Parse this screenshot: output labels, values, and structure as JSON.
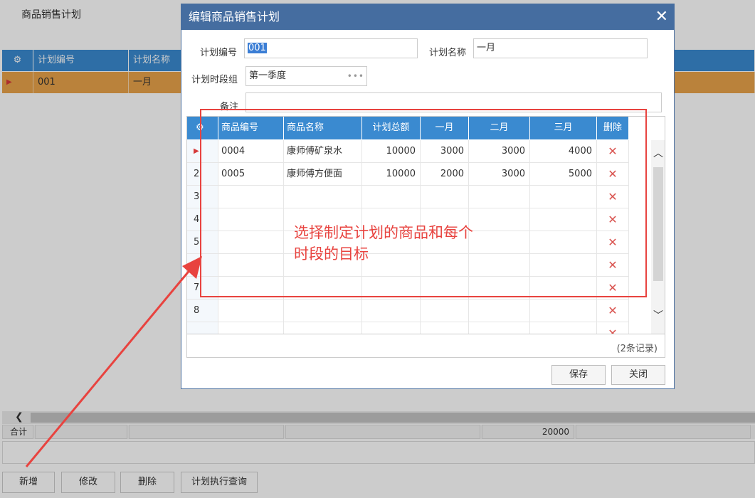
{
  "page": {
    "title": "商品销售计划"
  },
  "bg_grid": {
    "headers": [
      "计划编号",
      "计划名称"
    ],
    "row": {
      "code": "001",
      "name": "一月"
    },
    "footer": {
      "total_label": "合计",
      "total_value": "20000"
    }
  },
  "bg_buttons": {
    "add": "新增",
    "edit": "修改",
    "delete": "删除",
    "query": "计划执行查询"
  },
  "dialog": {
    "title": "编辑商品销售计划",
    "fields": {
      "code_label": "计划编号",
      "code_value": "001",
      "name_label": "计划名称",
      "name_value": "一月",
      "period_label": "计划时段组",
      "period_value": "第一季度",
      "remark_label": "备注",
      "remark_value": ""
    },
    "grid": {
      "headers": [
        "商品编号",
        "商品名称",
        "计划总额",
        "一月",
        "二月",
        "三月",
        "删除"
      ],
      "rows": [
        {
          "idx": "",
          "code": "0004",
          "name": "康师傅矿泉水",
          "total": "10000",
          "m1": "3000",
          "m2": "3000",
          "m3": "4000"
        },
        {
          "idx": "2",
          "code": "0005",
          "name": "康师傅方便面",
          "total": "10000",
          "m1": "2000",
          "m2": "3000",
          "m3": "5000"
        },
        {
          "idx": "3",
          "code": "",
          "name": "",
          "total": "",
          "m1": "",
          "m2": "",
          "m3": ""
        },
        {
          "idx": "4",
          "code": "",
          "name": "",
          "total": "",
          "m1": "",
          "m2": "",
          "m3": ""
        },
        {
          "idx": "5",
          "code": "",
          "name": "",
          "total": "",
          "m1": "",
          "m2": "",
          "m3": ""
        },
        {
          "idx": "",
          "code": "",
          "name": "",
          "total": "",
          "m1": "",
          "m2": "",
          "m3": ""
        },
        {
          "idx": "7",
          "code": "",
          "name": "",
          "total": "",
          "m1": "",
          "m2": "",
          "m3": ""
        },
        {
          "idx": "8",
          "code": "",
          "name": "",
          "total": "",
          "m1": "",
          "m2": "",
          "m3": ""
        },
        {
          "idx": "",
          "code": "",
          "name": "",
          "total": "",
          "m1": "",
          "m2": "",
          "m3": ""
        }
      ],
      "record_count": "(2条记录)"
    },
    "buttons": {
      "save": "保存",
      "close": "关闭"
    }
  },
  "annotation": {
    "line1": "选择制定计划的商品和每个",
    "line2": "时段的目标"
  },
  "colors": {
    "header_blue": "#3a8ad0",
    "selected_row": "#e9a34a",
    "annotation_red": "#e8433f",
    "dialog_title": "#456da0"
  },
  "icons": {
    "settings": "gear-icon",
    "delete": "close-x-icon",
    "current_row": "play-marker-icon"
  }
}
